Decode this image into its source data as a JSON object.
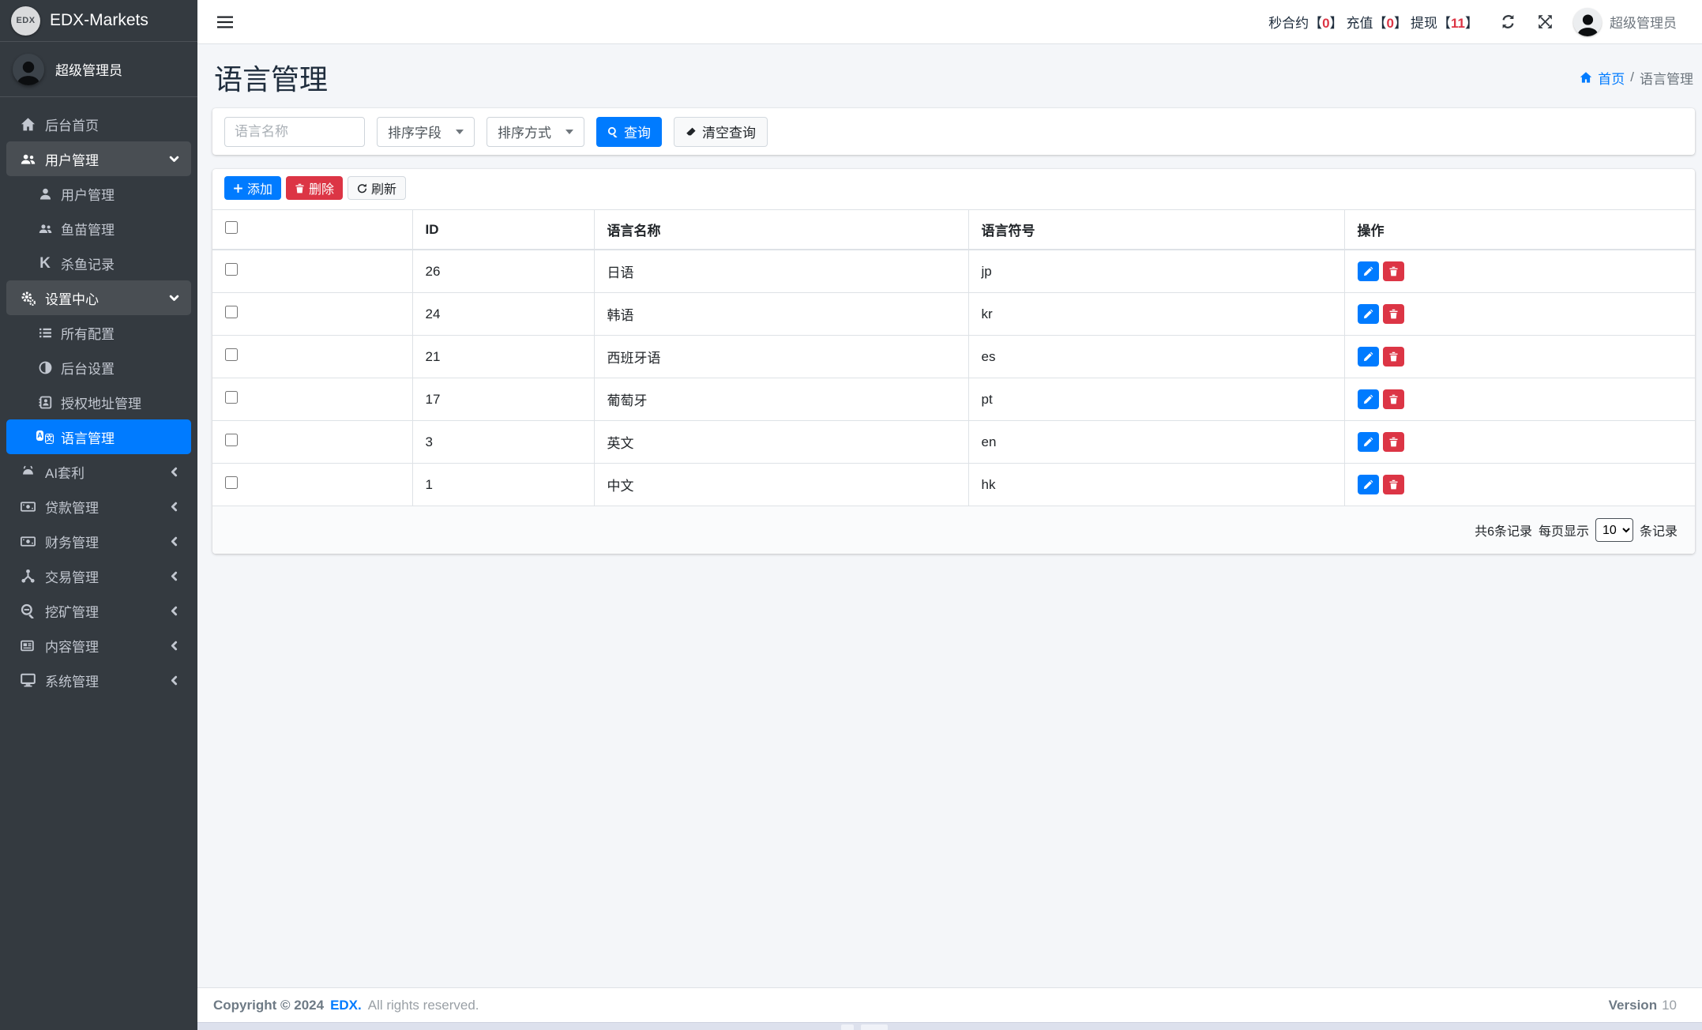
{
  "colors": {
    "accent": "#007bff",
    "danger": "#dc3545",
    "sidebar_bg": "#343a40",
    "stat_number": "#dc3545"
  },
  "brand": {
    "logo_text": "EDX",
    "name": "EDX-Markets"
  },
  "sidebar": {
    "user": "超级管理员",
    "items": [
      {
        "label": "后台首页"
      },
      {
        "label": "用户管理"
      },
      {
        "label": "用户管理"
      },
      {
        "label": "鱼苗管理"
      },
      {
        "label": "杀鱼记录"
      },
      {
        "label": "设置中心"
      },
      {
        "label": "所有配置"
      },
      {
        "label": "后台设置"
      },
      {
        "label": "授权地址管理"
      },
      {
        "label": "语言管理"
      },
      {
        "label": "AI套利"
      },
      {
        "label": "贷款管理"
      },
      {
        "label": "财务管理"
      },
      {
        "label": "交易管理"
      },
      {
        "label": "挖矿管理"
      },
      {
        "label": "内容管理"
      },
      {
        "label": "系统管理"
      }
    ]
  },
  "icons": {
    "kill_fish_letter": "K",
    "language_badge_1": "A",
    "language_badge_2": "文"
  },
  "topbar": {
    "bracket_open": "【",
    "bracket_close": "】",
    "stats": [
      {
        "label": "秒合约",
        "value": "0"
      },
      {
        "label": "充值",
        "value": "0"
      },
      {
        "label": "提现",
        "value": "11"
      }
    ],
    "user": "超级管理员"
  },
  "page": {
    "title": "语言管理",
    "breadcrumb": {
      "home": "首页",
      "separator": "/",
      "current": "语言管理"
    }
  },
  "filters": {
    "name_placeholder": "语言名称",
    "sort_field": "排序字段",
    "sort_order": "排序方式",
    "search_label": "查询",
    "clear_label": "清空查询"
  },
  "toolbar": {
    "add_label": "添加",
    "delete_label": "删除",
    "refresh_label": "刷新"
  },
  "table": {
    "columns": [
      "ID",
      "语言名称",
      "语言符号",
      "操作"
    ],
    "rows": [
      {
        "id": "26",
        "name": "日语",
        "code": "jp"
      },
      {
        "id": "24",
        "name": "韩语",
        "code": "kr"
      },
      {
        "id": "21",
        "name": "西班牙语",
        "code": "es"
      },
      {
        "id": "17",
        "name": "葡萄牙",
        "code": "pt"
      },
      {
        "id": "3",
        "name": "英文",
        "code": "en"
      },
      {
        "id": "1",
        "name": "中文",
        "code": "hk"
      }
    ],
    "pagination": {
      "total_text": "共6条记录",
      "per_page_prefix": "每页显示",
      "per_page_value": "10",
      "per_page_suffix": "条记录"
    }
  },
  "footer": {
    "copyright_prefix": "Copyright © 2024",
    "brand": "EDX.",
    "rights": "All rights reserved.",
    "version_label": "Version",
    "version_value": "10"
  }
}
